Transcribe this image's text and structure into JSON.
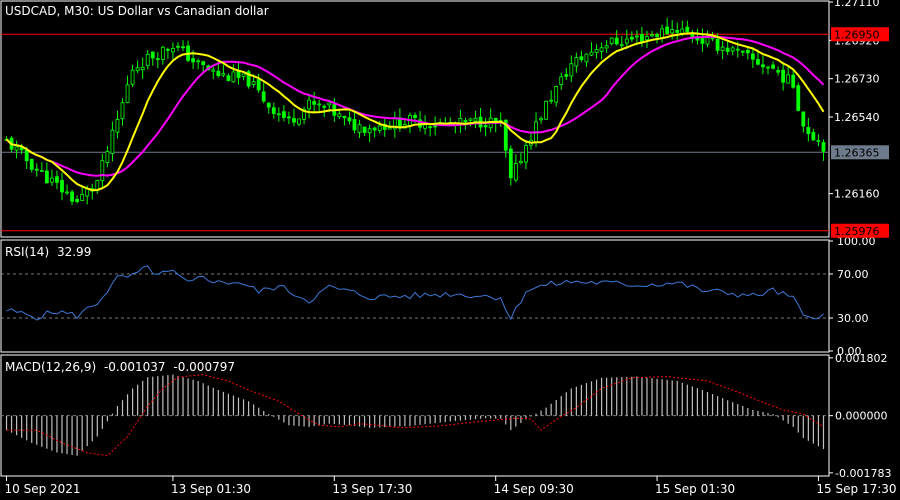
{
  "colors": {
    "background": "#000000",
    "frame": "#ffffff",
    "grid": "#7a7a7a",
    "text": "#ffffff",
    "bull_candle": "#00ff00",
    "bear_candle": "#00ff00",
    "ma_fast": "#ffff00",
    "ma_slow": "#ff00ff",
    "rsi_line": "#3c78d8",
    "macd_hist": "#c0c0c0",
    "macd_signal": "#ff0000",
    "level_line": "#ff0000",
    "current_line": "#6d7b8d",
    "level_badge": "#ff0000",
    "current_badge": "#6d7b8d"
  },
  "chart_data": [
    {
      "type": "candlestick",
      "panel": "main",
      "title": "USDCAD, M30:  US Dollar vs Canadian dollar",
      "symbol": "USDCAD",
      "timeframe": "M30",
      "description": "US Dollar vs Canadian dollar",
      "ylim": [
        1.2595,
        1.2711
      ],
      "y_ticks": [
        "1.27110",
        "1.26920",
        "1.26730",
        "1.26540",
        "1.26160"
      ],
      "levels": [
        {
          "value": 1.2695,
          "label": "1.26950",
          "kind": "resistance"
        },
        {
          "value": 1.25976,
          "label": "1.25976",
          "kind": "support"
        }
      ],
      "current_price": {
        "value": 1.26365,
        "label": "1.26365"
      },
      "close_path": [
        [
          0,
          1.2642
        ],
        [
          6,
          1.2628
        ],
        [
          10,
          1.262
        ],
        [
          14,
          1.2612
        ],
        [
          18,
          1.2622
        ],
        [
          22,
          1.2652
        ],
        [
          25,
          1.2678
        ],
        [
          28,
          1.2683
        ],
        [
          33,
          1.269
        ],
        [
          38,
          1.268
        ],
        [
          42,
          1.2675
        ],
        [
          48,
          1.2672
        ],
        [
          52,
          1.266
        ],
        [
          56,
          1.2652
        ],
        [
          60,
          1.266
        ],
        [
          64,
          1.2658
        ],
        [
          68,
          1.265
        ],
        [
          72,
          1.2649
        ],
        [
          80,
          1.2652
        ],
        [
          88,
          1.265
        ],
        [
          95,
          1.2652
        ],
        [
          98,
          1.265
        ],
        [
          100,
          1.2622
        ],
        [
          103,
          1.264
        ],
        [
          107,
          1.266
        ],
        [
          112,
          1.268
        ],
        [
          118,
          1.269
        ],
        [
          125,
          1.2693
        ],
        [
          133,
          1.2698
        ],
        [
          138,
          1.2692
        ],
        [
          143,
          1.2688
        ],
        [
          148,
          1.2682
        ],
        [
          152,
          1.2678
        ],
        [
          156,
          1.267
        ],
        [
          158,
          1.265
        ],
        [
          162,
          1.264
        ]
      ],
      "candle_count": 163,
      "candle_seed": 11,
      "candle_noise": 0.0006,
      "wick_noise": 0.0005,
      "series": [
        {
          "name": "MA fast",
          "kind": "moving-average",
          "period": 10
        },
        {
          "name": "MA slow",
          "kind": "moving-average",
          "period": 20
        }
      ]
    },
    {
      "type": "line",
      "panel": "rsi",
      "indicator": "RSI(14)",
      "value_label": "32.99",
      "ylim": [
        0,
        100
      ],
      "y_ticks": [
        "100.00",
        "70.00",
        "30.00",
        "0.00"
      ],
      "dashed_levels": [
        70,
        30
      ],
      "path": [
        [
          0,
          37
        ],
        [
          6,
          31
        ],
        [
          10,
          36
        ],
        [
          14,
          32
        ],
        [
          18,
          44
        ],
        [
          22,
          66
        ],
        [
          25,
          68
        ],
        [
          28,
          76
        ],
        [
          30,
          69
        ],
        [
          33,
          72
        ],
        [
          36,
          61
        ],
        [
          39,
          68
        ],
        [
          42,
          62
        ],
        [
          46,
          63
        ],
        [
          50,
          54
        ],
        [
          54,
          59
        ],
        [
          58,
          50
        ],
        [
          60,
          46
        ],
        [
          64,
          58
        ],
        [
          68,
          54
        ],
        [
          72,
          49
        ],
        [
          80,
          50
        ],
        [
          88,
          52
        ],
        [
          95,
          50
        ],
        [
          98,
          49
        ],
        [
          100,
          29
        ],
        [
          103,
          55
        ],
        [
          107,
          60
        ],
        [
          112,
          63
        ],
        [
          118,
          62
        ],
        [
          125,
          60
        ],
        [
          133,
          62
        ],
        [
          138,
          55
        ],
        [
          143,
          53
        ],
        [
          148,
          50
        ],
        [
          152,
          55
        ],
        [
          156,
          48
        ],
        [
          158,
          31
        ],
        [
          162,
          33
        ]
      ]
    },
    {
      "type": "bar+line",
      "panel": "macd",
      "indicator": "MACD(12,26,9)",
      "value_main": "-0.001037",
      "value_signal": "-0.000797",
      "ylim": [
        -0.00185,
        0.00186
      ],
      "y_ticks": [
        "0.001802",
        "0.000000",
        "-0.001783"
      ],
      "zero_dashed": true,
      "histogram_path": [
        [
          0,
          -0.00045
        ],
        [
          5,
          -0.00085
        ],
        [
          10,
          -0.00115
        ],
        [
          14,
          -0.00125
        ],
        [
          18,
          -0.00065
        ],
        [
          22,
          0.0003
        ],
        [
          25,
          0.00085
        ],
        [
          28,
          0.0012
        ],
        [
          33,
          0.00128
        ],
        [
          38,
          0.00108
        ],
        [
          42,
          0.0008
        ],
        [
          48,
          0.00045
        ],
        [
          52,
          5e-05
        ],
        [
          56,
          -0.0003
        ],
        [
          60,
          -0.00035
        ],
        [
          64,
          -0.00025
        ],
        [
          68,
          -0.0003
        ],
        [
          72,
          -0.00038
        ],
        [
          80,
          -0.00032
        ],
        [
          88,
          -0.00018
        ],
        [
          95,
          -8e-05
        ],
        [
          98,
          -0.0001
        ],
        [
          100,
          -0.00045
        ],
        [
          103,
          -0.00012
        ],
        [
          107,
          0.00025
        ],
        [
          112,
          0.00085
        ],
        [
          118,
          0.00118
        ],
        [
          125,
          0.00122
        ],
        [
          133,
          0.00108
        ],
        [
          138,
          0.0008
        ],
        [
          143,
          0.00048
        ],
        [
          148,
          0.00018
        ],
        [
          152,
          5e-05
        ],
        [
          156,
          -0.00035
        ],
        [
          158,
          -0.0007
        ],
        [
          162,
          -0.00104
        ]
      ],
      "signal_lag": 6,
      "series": [
        {
          "name": "MACD",
          "kind": "histogram"
        },
        {
          "name": "Signal",
          "kind": "dotted-line"
        }
      ]
    }
  ],
  "time_axis": {
    "labels": [
      {
        "text": "10 Sep 2021",
        "candle": 0
      },
      {
        "text": "13 Sep 01:30",
        "candle": 33
      },
      {
        "text": "13 Sep 17:30",
        "candle": 65
      },
      {
        "text": "14 Sep 09:30",
        "candle": 97
      },
      {
        "text": "15 Sep 01:30",
        "candle": 129
      },
      {
        "text": "15 Sep 17:30",
        "candle": 161
      }
    ]
  }
}
